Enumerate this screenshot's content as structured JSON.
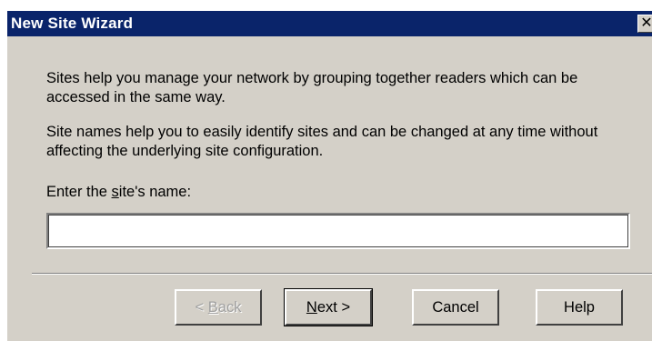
{
  "window": {
    "title": "New Site Wizard",
    "close_glyph": "✕"
  },
  "content": {
    "paragraph1": "Sites help you manage your network by grouping together readers which can be accessed in the same way.",
    "paragraph2": "Site names help you to easily identify sites and can be changed at any time without affecting the underlying site configuration.",
    "name_label_prefix": "Enter the ",
    "name_label_accel": "s",
    "name_label_suffix": "ite's name:",
    "name_value": ""
  },
  "buttons": {
    "back_prefix": "< ",
    "back_accel": "B",
    "back_suffix": "ack",
    "next_accel": "N",
    "next_suffix": "ext >",
    "cancel": "Cancel",
    "help": "Help"
  },
  "colors": {
    "titlebar": "#0a246a",
    "dialog": "#d4d0c8"
  }
}
